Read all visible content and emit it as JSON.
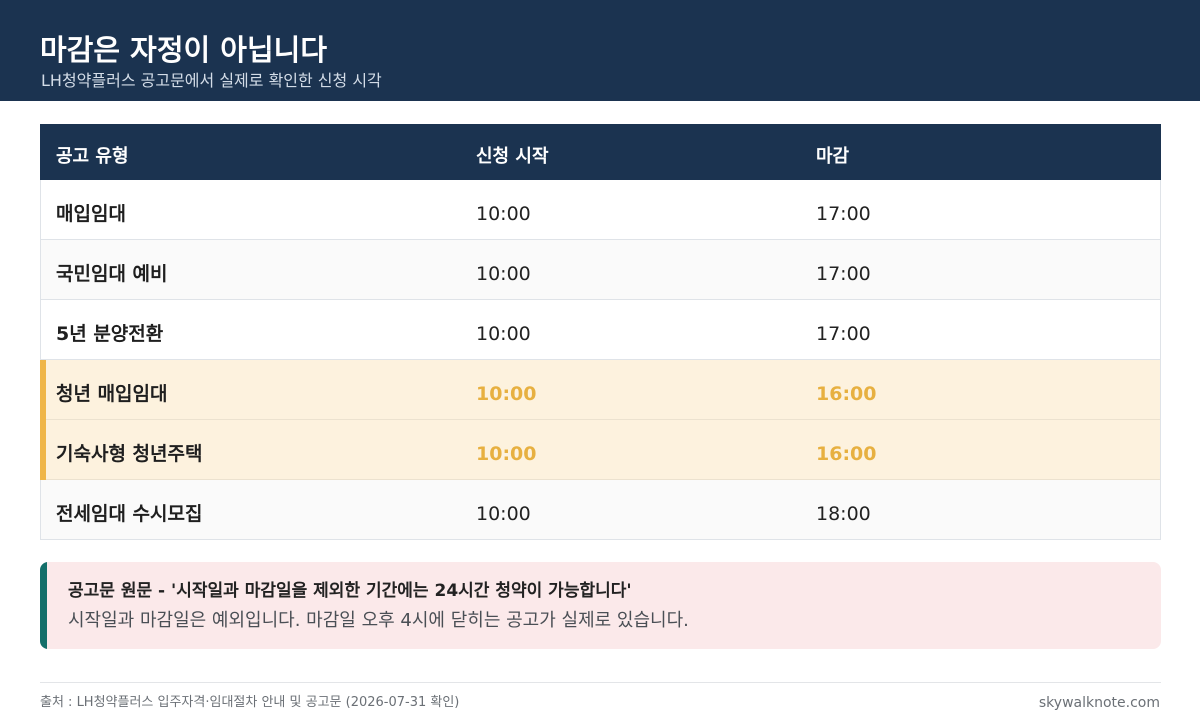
{
  "header": {
    "title": "마감은 자정이 아닙니다",
    "subtitle": "LH청약플러스 공고문에서 실제로 확인한 신청 시각"
  },
  "table": {
    "columns": [
      "공고 유형",
      "신청 시작",
      "마감"
    ],
    "rows": [
      {
        "type": "매입임대",
        "start": "10:00",
        "end": "17:00",
        "highlight": false
      },
      {
        "type": "국민임대 예비",
        "start": "10:00",
        "end": "17:00",
        "highlight": false
      },
      {
        "type": "5년 분양전환",
        "start": "10:00",
        "end": "17:00",
        "highlight": false
      },
      {
        "type": "청년 매입임대",
        "start": "10:00",
        "end": "16:00",
        "highlight": true
      },
      {
        "type": "기숙사형 청년주택",
        "start": "10:00",
        "end": "16:00",
        "highlight": true
      },
      {
        "type": "전세임대 수시모집",
        "start": "10:00",
        "end": "18:00",
        "highlight": false
      }
    ],
    "highlight_color": "#efb649",
    "header_color": "#1b3350"
  },
  "notice": {
    "title": "공고문 원문 - '시작일과 마감일을 제외한 기간에는 24시간 청약이 가능합니다'",
    "body": "시작일과 마감일은 예외입니다. 마감일 오후 4시에 닫히는 공고가 실제로 있습니다.",
    "accent_color": "#146f6a"
  },
  "footer": {
    "source": "출처 : LH청약플러스 입주자격·임대절차 안내 및 공고문 (2026-07-31 확인)",
    "site": "skywalknote.com"
  }
}
